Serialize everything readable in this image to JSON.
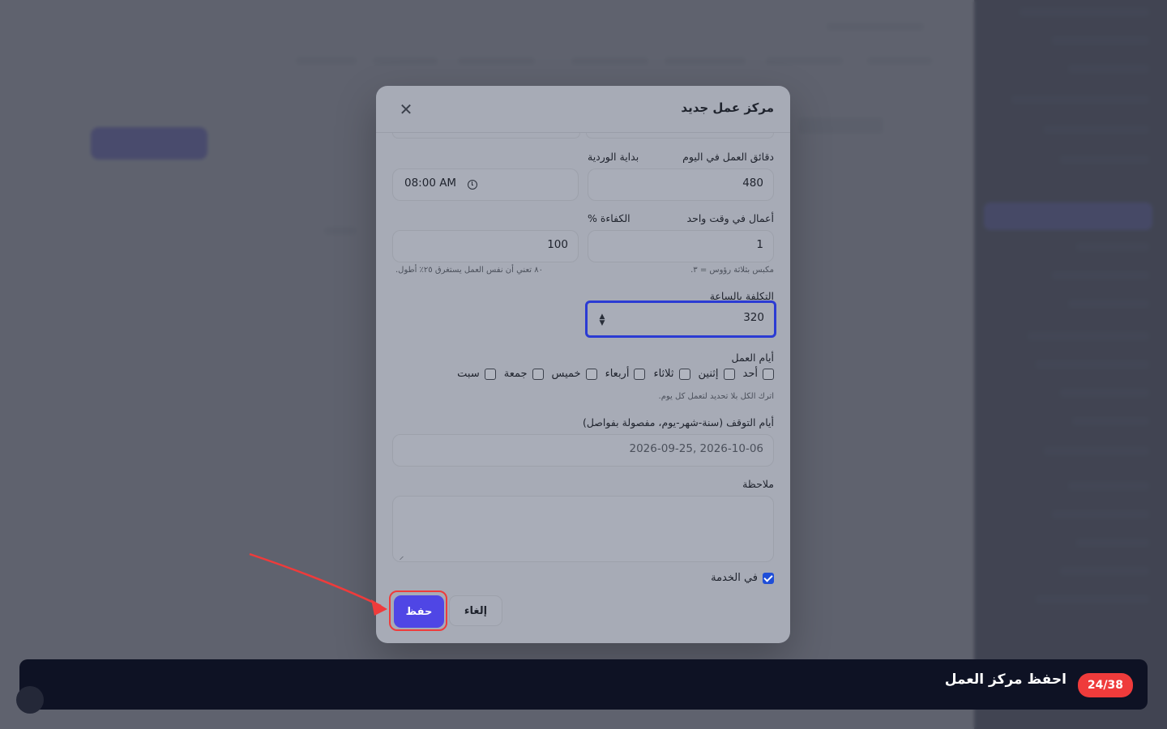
{
  "modal": {
    "title": "مركز عمل جديد",
    "close_icon": "close-icon",
    "fields": {
      "work_minutes_label": "دقائق العمل في اليوم",
      "work_minutes_value": "480",
      "shift_start_label": "بداية الوردية",
      "shift_start_value": "08:00 AM",
      "parallel_jobs_label": "أعمال في وقت واحد",
      "parallel_jobs_value": "1",
      "parallel_jobs_hint": "مكبس بثلاثة رؤوس = ٣.",
      "efficiency_label": "الكفاءة %",
      "efficiency_value": "100",
      "efficiency_hint": "٨٠ تعني أن نفس العمل يستغرق ٢٥٪ أطول.",
      "hourly_cost_label": "التكلفة بالساعة",
      "hourly_cost_value": "320",
      "work_days_label": "أيام العمل",
      "work_days": [
        "أحد",
        "إثنين",
        "ثلاثاء",
        "أربعاء",
        "خميس",
        "جمعة",
        "سبت"
      ],
      "work_days_hint": "اترك الكل بلا تحديد لتعمل كل يوم.",
      "stop_days_label": "أيام التوقف (سنة-شهر-يوم، مفصولة بفواصل)",
      "stop_days_placeholder": "2026-09-25, 2026-10-06",
      "note_label": "ملاحظة",
      "in_service_label": "في الخدمة"
    },
    "buttons": {
      "cancel": "إلغاء",
      "save": "حفظ"
    }
  },
  "tutorial": {
    "step": "24/38",
    "title": "احفظ مركز العمل"
  },
  "colors": {
    "accent": "#4f46e5",
    "highlight": "#ef3b3b",
    "focus": "#2b3bd3"
  }
}
